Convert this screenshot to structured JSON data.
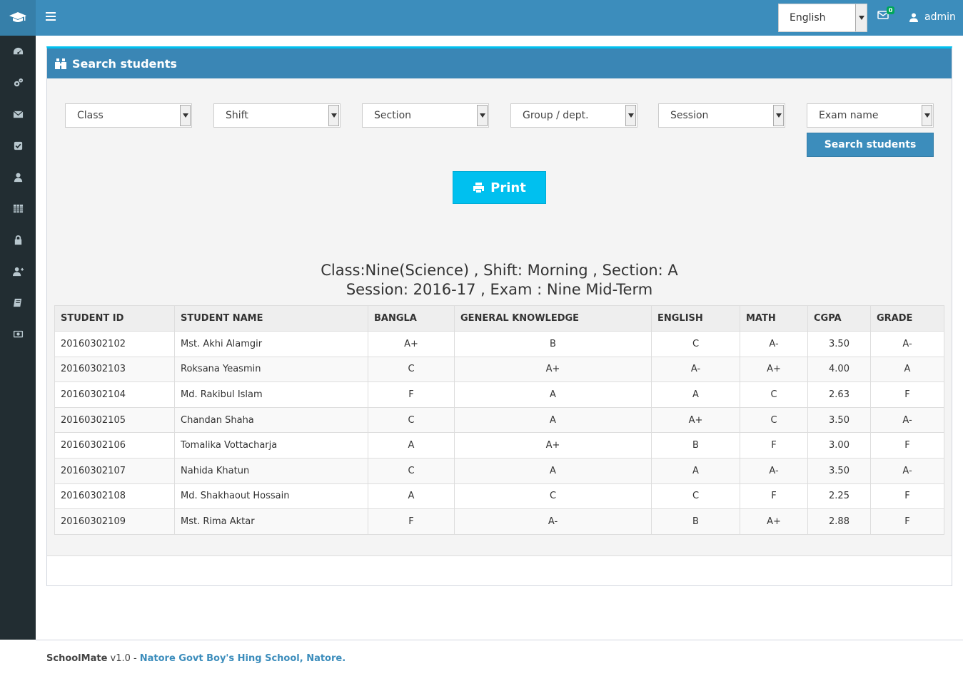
{
  "header": {
    "language": "English",
    "mail_count": "0",
    "user": "admin"
  },
  "sidebar": {
    "items": [
      {
        "icon": "dashboard-icon"
      },
      {
        "icon": "cogs-icon"
      },
      {
        "icon": "envelope-icon"
      },
      {
        "icon": "check-square-icon"
      },
      {
        "icon": "user-icon"
      },
      {
        "icon": "table-icon"
      },
      {
        "icon": "lock-icon"
      },
      {
        "icon": "user-plus-icon"
      },
      {
        "icon": "book-icon"
      },
      {
        "icon": "money-icon"
      }
    ]
  },
  "panel": {
    "title": "Search students"
  },
  "filters": {
    "class": "Class",
    "shift": "Shift",
    "section": "Section",
    "group": "Group / dept.",
    "session": "Session",
    "exam": "Exam name",
    "search_button": "Search students"
  },
  "print_button": "Print",
  "report": {
    "line1": "Class:Nine(Science) , Shift: Morning , Section: A",
    "line2": "Session: 2016-17 , Exam : Nine Mid-Term"
  },
  "table": {
    "headers": [
      "STUDENT ID",
      "STUDENT NAME",
      "BANGLA",
      "GENERAL KNOWLEDGE",
      "ENGLISH",
      "MATH",
      "CGPA",
      "GRADE"
    ],
    "rows": [
      [
        "20160302102",
        "Mst. Akhi Alamgir",
        "A+",
        "B",
        "C",
        "A-",
        "3.50",
        "A-"
      ],
      [
        "20160302103",
        "Roksana Yeasmin",
        "C",
        "A+",
        "A-",
        "A+",
        "4.00",
        "A"
      ],
      [
        "20160302104",
        "Md. Rakibul Islam",
        "F",
        "A",
        "A",
        "C",
        "2.63",
        "F"
      ],
      [
        "20160302105",
        "Chandan Shaha",
        "C",
        "A",
        "A+",
        "C",
        "3.50",
        "A-"
      ],
      [
        "20160302106",
        "Tomalika Vottacharja",
        "A",
        "A+",
        "B",
        "F",
        "3.00",
        "F"
      ],
      [
        "20160302107",
        "Nahida Khatun",
        "C",
        "A",
        "A",
        "A-",
        "3.50",
        "A-"
      ],
      [
        "20160302108",
        "Md. Shakhaout Hossain",
        "A",
        "C",
        "C",
        "F",
        "2.25",
        "F"
      ],
      [
        "20160302109",
        "Mst. Rima Aktar",
        "F",
        "A-",
        "B",
        "A+",
        "2.88",
        "F"
      ]
    ]
  },
  "footer": {
    "app": "SchoolMate",
    "version": "v1.0 -",
    "school": "Natore Govt Boy's Hing School, Natore."
  }
}
